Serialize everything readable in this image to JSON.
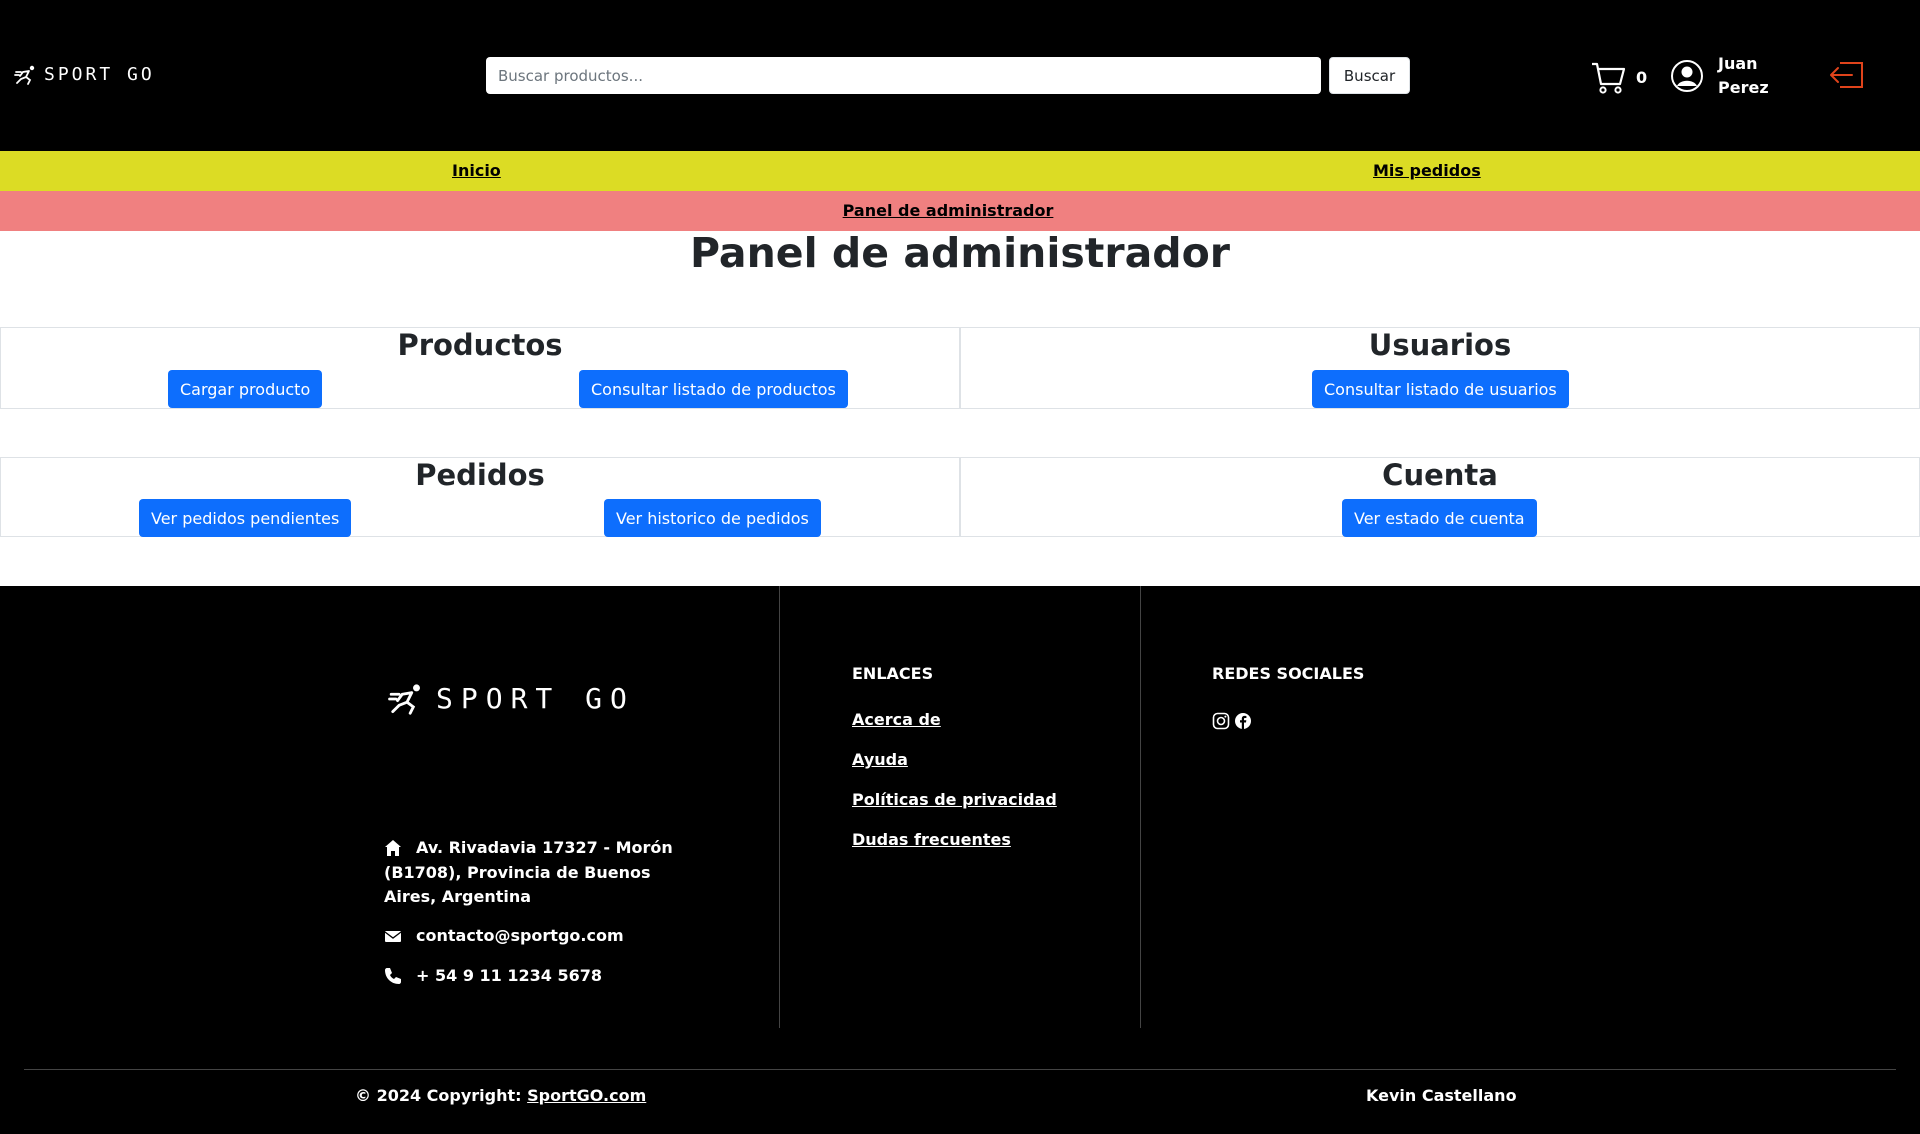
{
  "header": {
    "logo_text": "SPORT GO",
    "search": {
      "placeholder": "Buscar productos...",
      "value": ""
    },
    "search_button_label": "Buscar",
    "cart_count": "0",
    "user_name": "Juan Perez",
    "logout_icon": "logout-icon"
  },
  "nav": {
    "items": [
      {
        "label": "Inicio"
      },
      {
        "label": "Mis pedidos"
      }
    ],
    "admin_label": "Panel de administrador"
  },
  "main": {
    "title": "Panel de administrador",
    "sections": [
      {
        "title": "Productos",
        "buttons": [
          "Cargar producto",
          "Consultar listado de productos"
        ]
      },
      {
        "title": "Usuarios",
        "buttons": [
          "Consultar listado de usuarios"
        ]
      },
      {
        "title": "Pedidos",
        "buttons": [
          "Ver pedidos pendientes",
          "Ver historico de pedidos"
        ]
      },
      {
        "title": "Cuenta",
        "buttons": [
          "Ver estado de cuenta"
        ]
      }
    ]
  },
  "footer": {
    "logo_text": "SPORT GO",
    "address": "Av. Rivadavia 17327 - Morón (B1708), Provincia de Buenos Aires, Argentina",
    "email": "contacto@sportgo.com",
    "phone": "+ 54 9 11 1234 5678",
    "links_heading": "ENLACES",
    "links": [
      "Acerca de",
      "Ayuda",
      "Políticas de privacidad",
      "Dudas frecuentes"
    ],
    "social_heading": "REDES SOCIALES",
    "social_icons": [
      "instagram-icon",
      "facebook-icon"
    ],
    "copyright_prefix": "© 2024 Copyright:",
    "copyright_link": "SportGO.com",
    "author": "Kevin Castellano"
  },
  "colors": {
    "header_bg": "#000000",
    "nav_yellow": "#dcdc24",
    "nav_red": "#f08080",
    "primary_button": "#0d6efd",
    "logout_icon": "#e0431b"
  }
}
